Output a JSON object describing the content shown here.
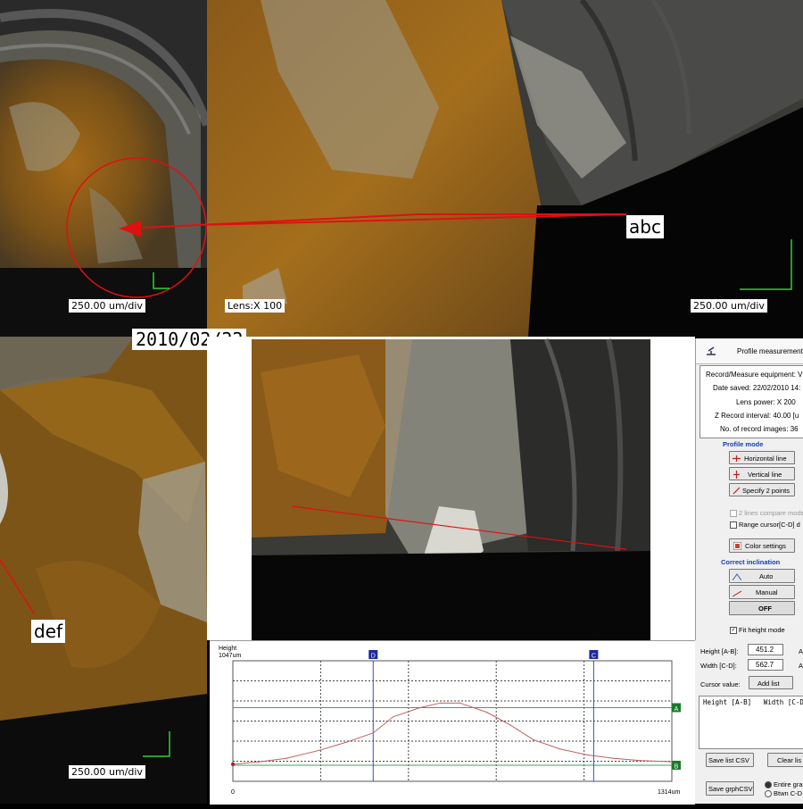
{
  "labels": {
    "scale_top_left": "250.00 um/div",
    "lens_top": "Lens:X 100",
    "scale_top_right": "250.00 um/div",
    "scale_bottom_left": "250.00 um/div",
    "callout_top": "abc",
    "callout_bottom": "def",
    "date": "2010/02/22"
  },
  "panel": {
    "title": "Profile measurement",
    "info": [
      "Record/Measure equipment: V",
      "Date saved: 22/02/2010 14:",
      "Lens power: X 200",
      "Z Record interval: 40.00 [u",
      "No. of record images: 36"
    ],
    "profile_mode": "Profile mode",
    "buttons": {
      "horizontal": "Horizontal line",
      "vertical": "Vertical line",
      "two_points": "Specify 2 points",
      "color": "Color settings",
      "auto": "Auto",
      "manual": "Manual",
      "off": "OFF"
    },
    "lines_compare": "2 lines compare mode",
    "range_cursor": "Range cursor[C-D] d",
    "correct_inclination": "Correct inclination",
    "fit_height": "Fit height mode"
  },
  "measure": {
    "height_label": "Height [A-B]:",
    "height_value": "451.2",
    "width_label": "Width [C-D]:",
    "width_value": "562.7",
    "unit_h": "A",
    "unit_w": "A",
    "cursor_label": "Cursor value:",
    "add_list": "Add list",
    "list_header": "Height [A-B]   Width [C-D",
    "save_list": "Save list CSV",
    "clear_list": "Clear lis",
    "save_graph": "Save grphCSV",
    "radio_entire": "Entire gra",
    "radio_between": "Btwn C-D"
  },
  "chart_data": {
    "type": "line",
    "ylabel": "Height",
    "ytop_label": "1047um",
    "x_start_label": "0",
    "x_end_label": "1314um",
    "xlim": [
      0,
      1314
    ],
    "ylim": [
      0,
      1047
    ],
    "x": [
      0,
      80,
      160,
      260,
      340,
      420,
      480,
      560,
      620,
      680,
      760,
      830,
      900,
      980,
      1060,
      1140,
      1220,
      1314
    ],
    "y": [
      148,
      170,
      200,
      270,
      340,
      420,
      560,
      640,
      680,
      680,
      600,
      490,
      360,
      280,
      230,
      200,
      180,
      170
    ],
    "series_color": "#c06060",
    "cursors": {
      "A": 640,
      "B": 140,
      "C_x": 1080,
      "D_x": 420
    },
    "cursor_labels": {
      "A": "A",
      "B": "B",
      "C": "C",
      "D": "D"
    }
  }
}
